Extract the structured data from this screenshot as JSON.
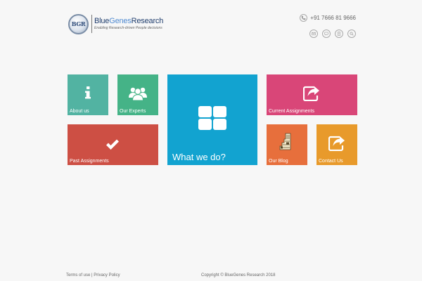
{
  "brand": {
    "badge": "BGR",
    "name_part1": "Blue",
    "name_part2": "Genes",
    "name_part3": "Research",
    "tagline": "Enabling Research-driven People decisions"
  },
  "contact": {
    "phone_icon": "phone-icon",
    "phone": "+91 7666 81 9666"
  },
  "social_icons": [
    "email-icon",
    "chat-icon",
    "document-icon",
    "search-icon"
  ],
  "tiles": {
    "about": {
      "label": "About us",
      "icon": "info-icon",
      "color": "#52b3a2"
    },
    "experts": {
      "label": "Our Experts",
      "icon": "team-icon",
      "color": "#45b387"
    },
    "past": {
      "label": "Past Assignments",
      "icon": "checkmark-icon",
      "color": "#cd4f44"
    },
    "what": {
      "label": "What we do?",
      "icon": "grid-icon",
      "color": "#12a3d0"
    },
    "current": {
      "label": "Current Assignments",
      "icon": "share-icon",
      "color": "#d94678"
    },
    "blog": {
      "label": "Our Blog",
      "icon": "blog-icon",
      "color": "#e76f3c"
    },
    "contact": {
      "label": "Contact Us",
      "icon": "share-icon",
      "color": "#e89a2b"
    }
  },
  "footer": {
    "terms": "Terms of use",
    "separator": "|",
    "privacy": "Privacy Policy",
    "copyright": "Copyright © BlueGenes Research 2018"
  }
}
